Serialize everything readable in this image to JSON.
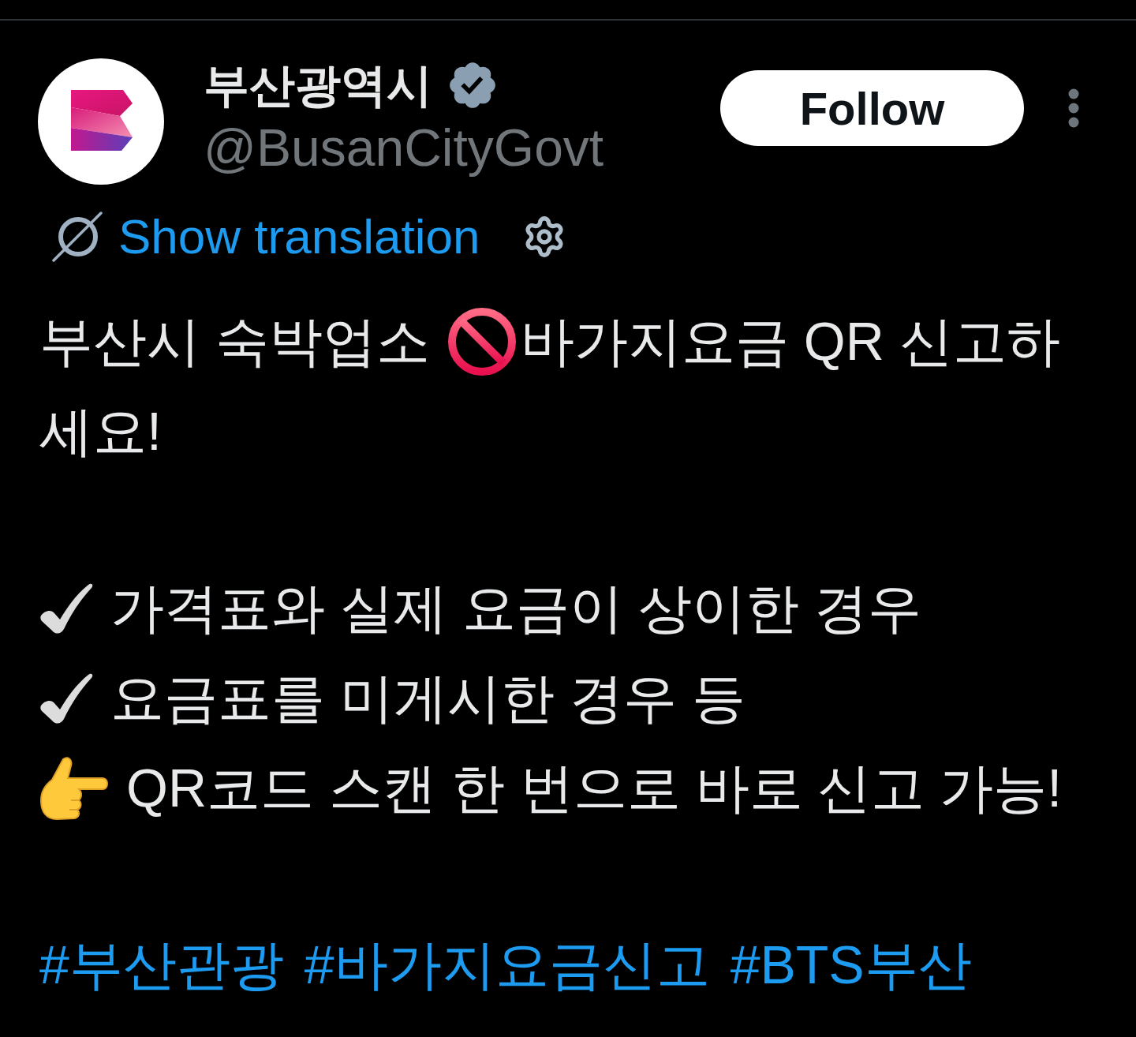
{
  "post": {
    "author": {
      "name": "부산광역시",
      "verified": true,
      "handle": "@BusanCityGovt"
    },
    "follow_button": {
      "label": "Follow"
    },
    "translation": {
      "label": "Show translation"
    },
    "paragraphs": [
      {
        "lines": [
          {
            "kind": "prohibited",
            "before": "부산시 숙박업소",
            "after": "바가지요금 QR 신고하"
          },
          {
            "kind": "plain",
            "text": "세요!"
          }
        ]
      },
      {
        "lines": [
          {
            "kind": "check",
            "text": "가격표와 실제 요금이 상이한 경우"
          },
          {
            "kind": "check",
            "text": "요금표를 미게시한 경우 등"
          },
          {
            "kind": "pointer",
            "text": "QR코드 스캔 한 번으로 바로 신고 가능!"
          }
        ]
      }
    ],
    "hashtags": [
      "#부산관광",
      "#바가지요금신고",
      "#BTS부산"
    ]
  }
}
